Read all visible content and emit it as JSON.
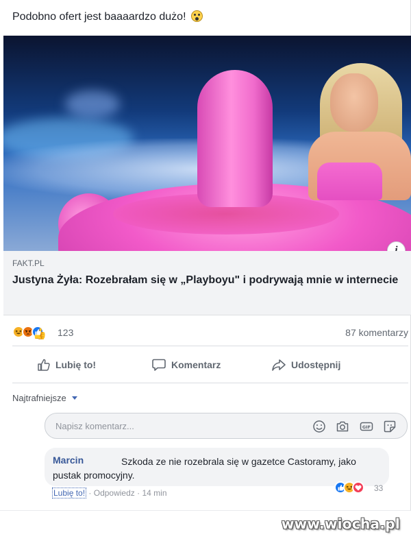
{
  "post": {
    "text": "Podobno ofert jest baaaardzo dużo!",
    "emoji": "scream-emoji"
  },
  "link_preview": {
    "image": "flamingo-pool-photo",
    "info_label": "i",
    "source": "FAKT.PL",
    "title": "Justyna Żyła: Rozebrałam się w „Playboyu\" i podrywają mnie w internecie"
  },
  "stats": {
    "reactions": [
      "haha",
      "angry",
      "like"
    ],
    "reaction_count": "123",
    "comments_count": "87 komentarzy"
  },
  "actions": {
    "like_label": "Lubię to!",
    "comment_label": "Komentarz",
    "share_label": "Udostępnij"
  },
  "comments_section": {
    "sort_label": "Najtrafniejsze",
    "input_placeholder": "Napisz komentarz...",
    "input_icons": [
      "emoji-icon",
      "camera-icon",
      "gif-icon",
      "sticker-icon"
    ]
  },
  "top_comment": {
    "author": "Marcin",
    "text": "Szkoda ze nie rozebrala się w gazetce Castoramy, jako pustak promocyjny.",
    "like_link": "Lubię to!",
    "reply_link": "Odpowiedz",
    "time": "14 min",
    "reactions": [
      "like",
      "haha",
      "love"
    ],
    "reaction_count": "33"
  },
  "watermark": "www.wiocha.pl",
  "colors": {
    "link_blue": "#385898",
    "action_blue": "#4267b2",
    "muted_text": "#606770",
    "caption_bg": "#f2f3f5",
    "flamingo_pink": "#f25ac9"
  }
}
